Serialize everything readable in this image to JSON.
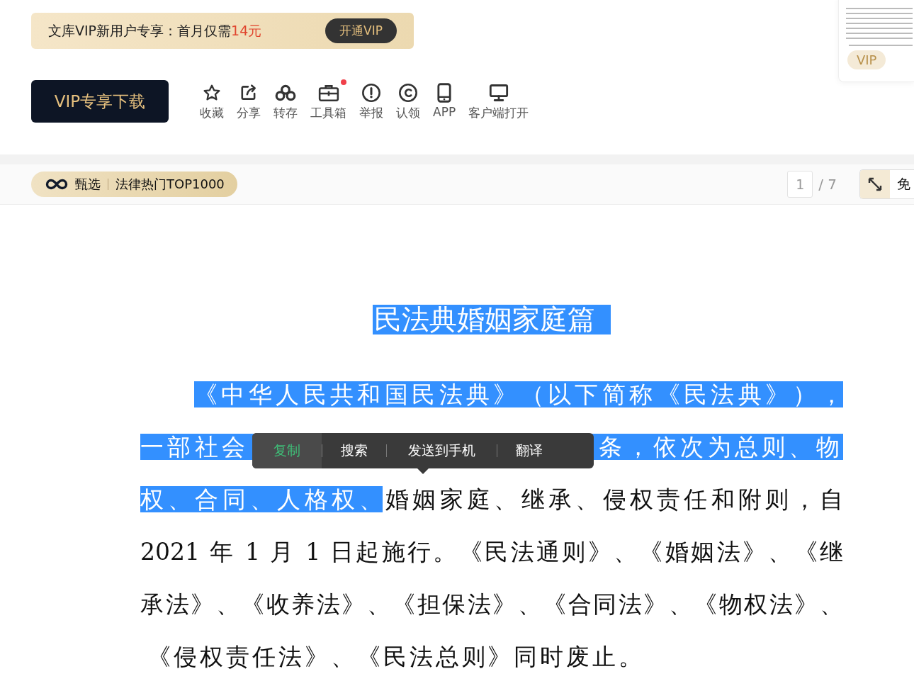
{
  "promo_banner": {
    "text": "文库VIP新用户专享：首月仅需",
    "price": "14元",
    "button": "开通VIP"
  },
  "download_button": "VIP专享下载",
  "toolbar": [
    {
      "kind": "star",
      "label": "收藏"
    },
    {
      "kind": "share",
      "label": "分享"
    },
    {
      "kind": "save",
      "label": "转存"
    },
    {
      "kind": "toolbox",
      "label": "工具箱",
      "dot": true
    },
    {
      "kind": "report",
      "label": "举报"
    },
    {
      "kind": "claim",
      "label": "认领"
    },
    {
      "kind": "phone",
      "label": "APP"
    },
    {
      "kind": "monitor",
      "label": "客户端打开"
    }
  ],
  "preview_thumbnail": {
    "badge": "VIP"
  },
  "collection_tag": {
    "brand": "甄选",
    "title": "法律热门TOP1000"
  },
  "pager": {
    "current": "1",
    "total": "/ 7"
  },
  "side_button": {
    "label": "免"
  },
  "document": {
    "title": {
      "text": "民法典婚姻家庭篇",
      "selected": true
    },
    "lines": [
      {
        "segments": [
          {
            "text": "《中华人民共和国民法典》（以下简称《民法典》），",
            "selected": true
          }
        ]
      },
      {
        "segments": [
          {
            "text": "一部社会",
            "selected": true
          },
          {
            "text": "条，依次为总则、物",
            "selected": true
          }
        ]
      },
      {
        "segments": [
          {
            "text": "权、合同、人格权、",
            "selected": true
          },
          {
            "text": "婚姻家庭、继承、侵权责任和附则，自",
            "selected": false
          }
        ]
      },
      {
        "segments": [
          {
            "text": "2021 年 1 月 1 日起施行。《民法通则》、《婚姻法》、《继",
            "selected": false
          }
        ]
      },
      {
        "segments": [
          {
            "text": "承法》、《收养法》、《担保法》、《合同法》、《物权法》、",
            "selected": false
          }
        ]
      },
      {
        "segments": [
          {
            "text": "《侵权责任法》、《民法总则》同时废止。",
            "selected": false
          }
        ]
      }
    ]
  },
  "selection_menu": [
    {
      "label": "复制",
      "selected": true
    },
    {
      "label": "搜索",
      "selected": false
    },
    {
      "label": "发送到手机",
      "selected": false
    },
    {
      "label": "翻译",
      "selected": false
    }
  ]
}
